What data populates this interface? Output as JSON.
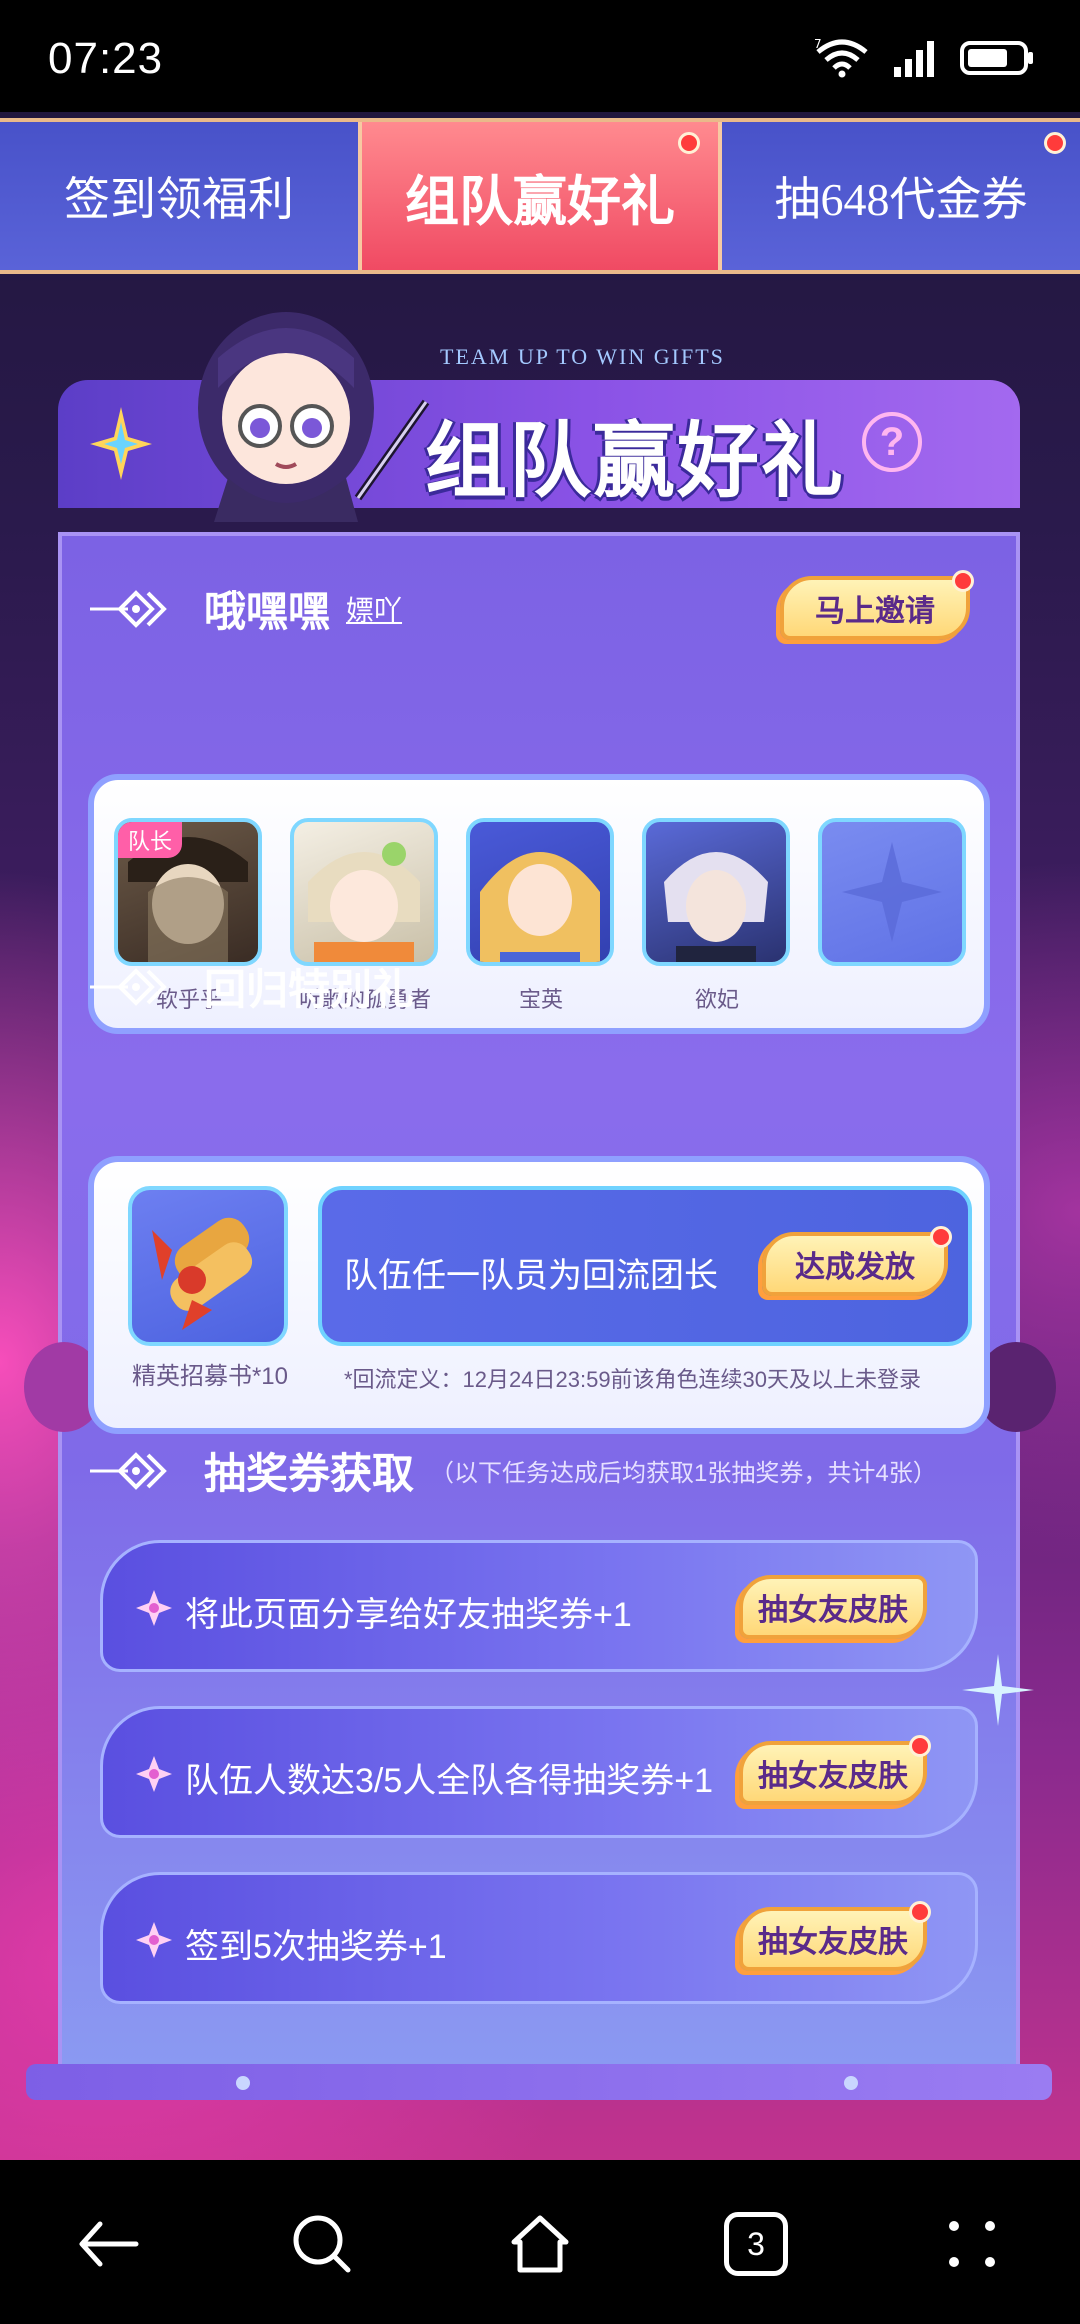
{
  "status_bar": {
    "time": "07:23",
    "battery_level": 0.75
  },
  "tabs": [
    {
      "label": "签到领福利",
      "active": false,
      "has_dot": false
    },
    {
      "label": "组队赢好礼",
      "active": true,
      "has_dot": true
    },
    {
      "label": "抽648代金券",
      "active": false,
      "has_dot": true
    }
  ],
  "header": {
    "subtitle": "TEAM UP TO WIN GIFTS",
    "title": "组队赢好礼",
    "help": "?"
  },
  "team": {
    "name": "哦嘿嘿",
    "tag": "嫖吖",
    "invite_label": "马上邀请",
    "leader_label": "队长",
    "members": [
      {
        "name": "软乎乎",
        "leader": true
      },
      {
        "name": "听歌的孤勇者",
        "leader": false
      },
      {
        "name": "宝英",
        "leader": false
      },
      {
        "name": "欲妃",
        "leader": false
      },
      {
        "name": "",
        "leader": false
      }
    ]
  },
  "return_gift": {
    "title": "回归特别礼",
    "item_label": "精英招募书*10",
    "condition": "队伍任一队员为回流团长",
    "button_label": "达成发放",
    "note": "*回流定义：12月24日23:59前该角色连续30天及以上未登录"
  },
  "lottery": {
    "title": "抽奖券获取",
    "subtitle": "（以下任务达成后均获取1张抽奖券，共计4张）",
    "tasks": [
      {
        "text": "将此页面分享给好友抽奖券+1",
        "button_label": "抽女友皮肤",
        "has_dot": false
      },
      {
        "text": "队伍人数达3/5人全队各得抽奖券+1",
        "button_label": "抽女友皮肤",
        "has_dot": true
      },
      {
        "text": "签到5次抽奖券+1",
        "button_label": "抽女友皮肤",
        "has_dot": true
      }
    ]
  },
  "nav": {
    "tabs_count": "3"
  },
  "colors": {
    "accent_pink": "#f04a63",
    "tab_blue": "#4852c9",
    "gold": "#ffd878"
  }
}
